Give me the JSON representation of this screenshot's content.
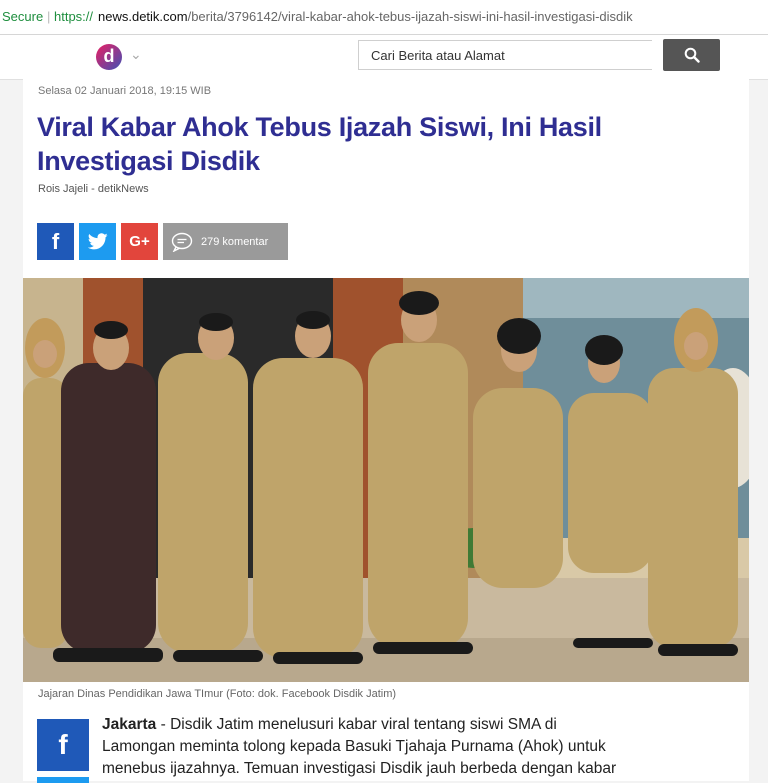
{
  "browser": {
    "secure_label": "Secure",
    "scheme": "https://",
    "domain": "news.detik.com",
    "path": "/berita/3796142/viral-kabar-ahok-tebus-ijazah-siswi-ini-hasil-investigasi-disdik"
  },
  "header": {
    "logo_letter": "d",
    "search_placeholder": "Cari Berita atau Alamat"
  },
  "article": {
    "date": "Selasa 02 Januari 2018, 19:15 WIB",
    "title": "Viral Kabar Ahok Tebus Ijazah Siswi, Ini Hasil Investigasi Disdik",
    "author": "Rois Jajeli - detikNews",
    "share": {
      "facebook_glyph": "f",
      "googleplus_glyph": "G+",
      "comments_label": "279 komentar"
    },
    "caption": "Jajaran Dinas Pendidikan Jawa TImur (Foto: dok. Facebook Disdik Jatim)",
    "dateline": "Jakarta",
    "body_lead": " - Disdik Jatim menelusuri kabar viral tentang siswi SMA di Lamongan meminta tolong kepada Basuki Tjahaja Purnama (Ahok) untuk menebus ijazahnya. Temuan investigasi Disdik jauh berbeda dengan kabar viral itu. Begini kabarnya.",
    "side_share_glyph": "f"
  },
  "colors": {
    "title": "#2f2e92",
    "facebook": "#1f59b8",
    "twitter": "#1d9bf0",
    "googleplus": "#e2453c",
    "comment": "#9a9a9a",
    "secure": "#1e8e3e"
  }
}
